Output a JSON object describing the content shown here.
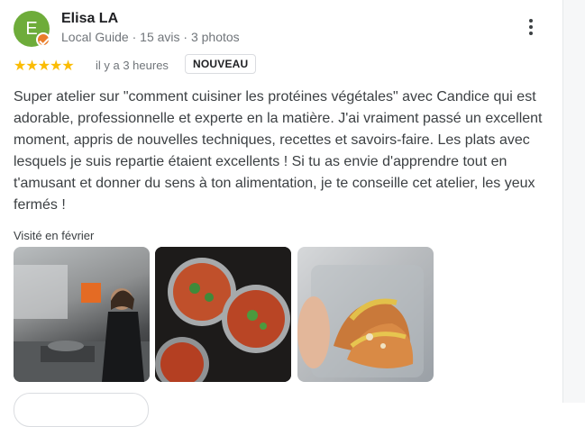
{
  "review": {
    "author": {
      "initial": "E",
      "name": "Elisa LA",
      "meta": "Local Guide · 15 avis · 3 photos"
    },
    "rating": 5,
    "stars": "★★★★★",
    "time": "il y a 3 heures",
    "badge": "NOUVEAU",
    "text": "Super atelier sur \"comment cuisiner les protéines végétales\" avec Candice qui est adorable, professionnelle et experte en la matière. J'ai vraiment passé un excellent moment, appris de nouvelles techniques, recettes et savoirs-faire. Les plats avec lesquels je suis repartie étaient excellents ! Si tu as envie d'apprendre tout en t'amusant et donner du sens à ton alimentation, je te conseille cet atelier, les yeux fermés !",
    "visited": "Visité en février"
  },
  "icons": {
    "more": "more-vert-icon",
    "local_guide": "local-guide-badge-icon",
    "star": "star-icon"
  },
  "colors": {
    "avatar": "#6eac3a",
    "guide_badge": "#ea7d2a",
    "stars": "#fbbc04"
  }
}
